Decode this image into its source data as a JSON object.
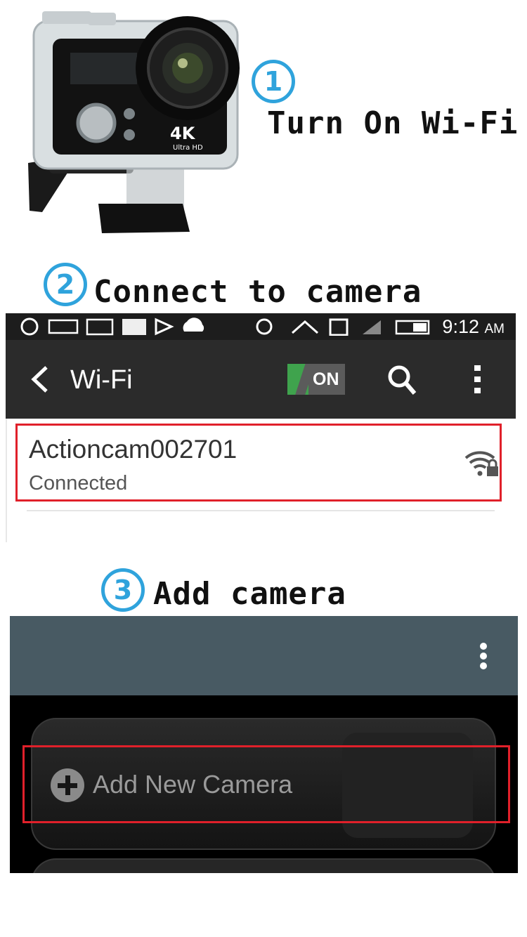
{
  "steps": [
    {
      "number": "1",
      "title": "Turn On Wi-Fi"
    },
    {
      "number": "2",
      "title": "Connect to camera"
    },
    {
      "number": "3",
      "title": "Add camera"
    }
  ],
  "camera": {
    "badge": "4K",
    "subtitle": "Ultra HD"
  },
  "wifi_screen": {
    "time": "9:12",
    "ampm": "AM",
    "title": "Wi-Fi",
    "toggle": "ON",
    "network": {
      "name": "Actioncam002701",
      "status": "Connected"
    },
    "icons": [
      "back-arrow-icon",
      "search-icon",
      "more-vert-icon",
      "wifi-lock-icon"
    ]
  },
  "app_screen": {
    "add_button_label": "Add New Camera",
    "icons": [
      "more-vert-icon",
      "plus-circle-icon"
    ],
    "header_color": "#485a63"
  },
  "colors": {
    "accent": "#2fa3dc",
    "highlight": "#e0202a",
    "toggle_on": "#3fa34d"
  }
}
